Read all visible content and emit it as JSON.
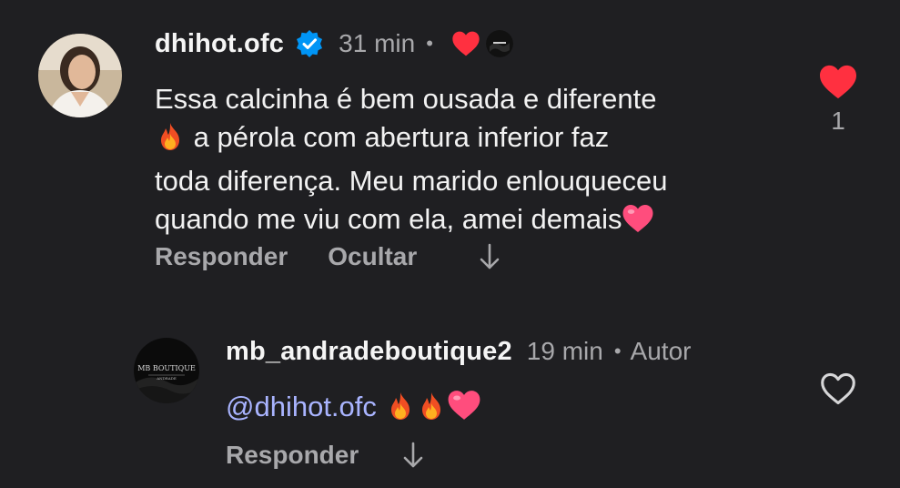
{
  "comments": [
    {
      "username": "dhihot.ofc",
      "verified": true,
      "time": "31 min",
      "separator": "•",
      "creator_liked": true,
      "text_lines": [
        "Essa calcinha é bem ousada e diferente",
        "a pérola com abertura inferior faz",
        "toda diferença. Meu marido enlouqueceu",
        "quando me viu com ela, amei demais"
      ],
      "actions": {
        "reply": "Responder",
        "hide": "Ocultar"
      },
      "likes": "1",
      "liked": true
    },
    {
      "username": "mb_andradeboutique2",
      "time": "19 min",
      "separator": "•",
      "author_label": "Autor",
      "avatar_text_top": "MB BOUTIQUE",
      "avatar_text_bottom": "ANDRADE",
      "mention": "@dhihot.ofc",
      "actions": {
        "reply": "Responder"
      },
      "liked": false
    }
  ],
  "colors": {
    "background": "#1f1f22",
    "like_red": "#ff3040",
    "verified_blue": "#0095f6",
    "mention": "#a9b4ff",
    "muted": "#a8a8ab"
  },
  "icons": {
    "verified": "verified-badge-icon",
    "heart_filled": "heart-filled-icon",
    "heart_outline": "heart-outline-icon",
    "fire": "fire-emoji",
    "pink_heart": "heart-emoji",
    "arrow_down": "arrow-down-icon"
  }
}
